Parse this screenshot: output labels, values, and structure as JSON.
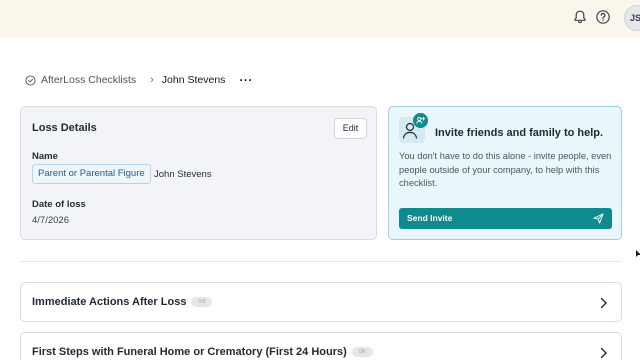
{
  "topbar": {
    "icons": [
      "bell-icon",
      "help-icon"
    ],
    "avatar_initials": "JS"
  },
  "breadcrumb": {
    "root": "AfterLoss Checklists",
    "separator": "›",
    "current": "John Stevens",
    "more": "···"
  },
  "loss_details": {
    "title": "Loss Details",
    "edit_label": "Edit",
    "name_label": "Name",
    "relationship": "Parent or Parental Figure",
    "person_name": "John Stevens",
    "date_label": "Date of loss",
    "date_value": "4/7/2026"
  },
  "invite": {
    "title": "Invite friends and family to help.",
    "description": "You don't have to do this alone - invite people, even people outside of your company, to help with this checklist.",
    "button_label": "Send Invite",
    "accent_color": "#0f8b8d"
  },
  "sections": [
    {
      "title": "Immediate Actions After Loss",
      "count": "0/8"
    },
    {
      "title": "First Steps with Funeral Home or Crematory (First 24 Hours)",
      "count": "0/6"
    }
  ]
}
